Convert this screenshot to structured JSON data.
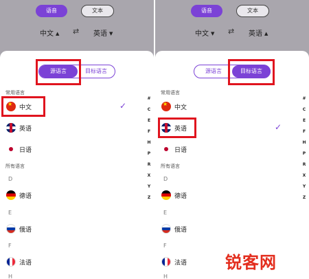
{
  "top": {
    "tab_voice": "语音",
    "tab_text": "文本",
    "source_lang": "中文",
    "swap_icon": "swap-arrows-icon",
    "target_lang": "英语"
  },
  "segment": {
    "source_label": "源语言",
    "target_label": "目标语言"
  },
  "sections": {
    "common": "常用语言",
    "all": "所有语言"
  },
  "common_languages": [
    {
      "label": "中文",
      "flag": "china-flag-icon"
    },
    {
      "label": "英语",
      "flag": "uk-flag-icon"
    },
    {
      "label": "日语",
      "flag": "japan-flag-icon"
    }
  ],
  "all_languages": [
    {
      "letter": "D",
      "label": "德语",
      "flag": "germany-flag-icon"
    },
    {
      "letter": "E",
      "label": "俄语",
      "flag": "russia-flag-icon"
    },
    {
      "letter": "F",
      "label": "法语",
      "flag": "france-flag-icon"
    }
  ],
  "trailing_letter": "H",
  "index_letters": [
    "#",
    "C",
    "E",
    "F",
    "H",
    "P",
    "R",
    "X",
    "Y",
    "Z"
  ],
  "panels": [
    {
      "active_segment": "source",
      "checked_language": "中文"
    },
    {
      "active_segment": "target",
      "checked_language": "英语"
    }
  ],
  "watermark": "锐客网",
  "colors": {
    "accent": "#7b42d6",
    "highlight": "#e0141e"
  }
}
